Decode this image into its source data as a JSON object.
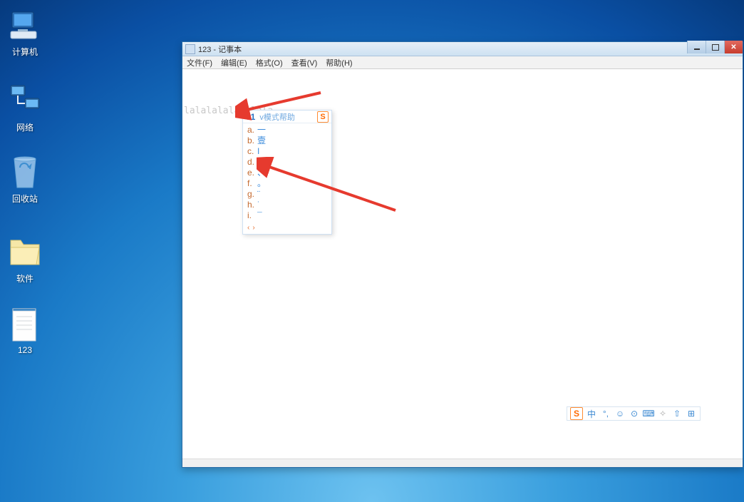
{
  "desktop": {
    "icons": [
      {
        "label": "计算机",
        "name": "computer"
      },
      {
        "label": "网络",
        "name": "network"
      },
      {
        "label": "回收站",
        "name": "recycle-bin"
      },
      {
        "label": "软件",
        "name": "software"
      },
      {
        "label": "123",
        "name": "file-123"
      }
    ]
  },
  "notepad": {
    "title": "123 - 记事本",
    "menu": {
      "file": "文件(F)",
      "edit": "编辑(E)",
      "format": "格式(O)",
      "view": "查看(V)",
      "help": "帮助(H)"
    },
    "content": "lalalalalalalala"
  },
  "ime": {
    "input": "v1",
    "mode_hint": "v模式帮助",
    "logo": "S",
    "candidates": [
      {
        "idx": "a.",
        "txt": "一"
      },
      {
        "idx": "b.",
        "txt": "壹"
      },
      {
        "idx": "c.",
        "txt": "I"
      },
      {
        "idx": "d.",
        "txt": "."
      },
      {
        "idx": "e.",
        "txt": "、"
      },
      {
        "idx": "f.",
        "txt": "。"
      },
      {
        "idx": "g.",
        "txt": "¨"
      },
      {
        "idx": "h.",
        "txt": "˙"
      },
      {
        "idx": "i.",
        "txt": "¯"
      }
    ],
    "nav": {
      "prev": "‹",
      "next": "›"
    }
  },
  "ime_toolbar": {
    "logo": "S",
    "buttons": [
      "中",
      "°,",
      "☺",
      "⊙",
      "⌨",
      "✧",
      "⇧",
      "⊞"
    ]
  }
}
